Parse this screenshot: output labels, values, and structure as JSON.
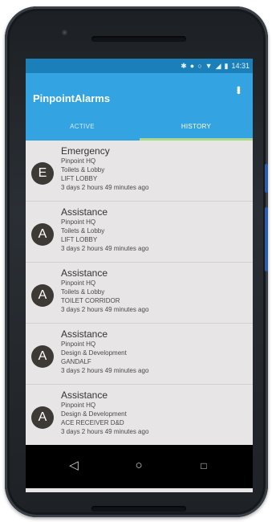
{
  "status_bar": {
    "time": "14:31",
    "icons": [
      "bluetooth-icon",
      "alarm-clock-icon",
      "do-not-disturb-icon",
      "wifi-icon",
      "signal-icon",
      "battery-icon"
    ]
  },
  "app_bar": {
    "title": "PinpointAlarms",
    "overflow_icon": "more-vert-icon"
  },
  "tabs": {
    "active_label": "ACTIVE",
    "history_label": "HISTORY",
    "selected": "HISTORY"
  },
  "alarms": [
    {
      "initial": "E",
      "type": "Emergency",
      "site": "Pinpoint HQ",
      "area": "Toilets & Lobby",
      "location": "LIFT LOBBY",
      "time": "3 days 2 hours 49 minutes ago"
    },
    {
      "initial": "A",
      "type": "Assistance",
      "site": "Pinpoint HQ",
      "area": "Toilets & Lobby",
      "location": "LIFT LOBBY",
      "time": "3 days 2 hours 49 minutes ago"
    },
    {
      "initial": "A",
      "type": "Assistance",
      "site": "Pinpoint HQ",
      "area": "Toilets & Lobby",
      "location": "TOILET CORRIDOR",
      "time": "3 days 2 hours 49 minutes ago"
    },
    {
      "initial": "A",
      "type": "Assistance",
      "site": "Pinpoint HQ",
      "area": "Design & Development",
      "location": "GANDALF",
      "time": "3 days 2 hours 49 minutes ago"
    },
    {
      "initial": "A",
      "type": "Assistance",
      "site": "Pinpoint HQ",
      "area": "Design & Development",
      "location": "ACE RECEIVER    D&D",
      "time": "3 days 2 hours 49 minutes ago"
    }
  ],
  "nav_bar": {
    "back_icon": "back-triangle-icon",
    "home_icon": "home-circle-icon",
    "recents_icon": "recents-square-icon"
  },
  "colors": {
    "app_bar": "#33a3e1",
    "status_bar": "#1b7fb9",
    "tab_indicator": "#a8d98c",
    "avatar": "#3d3a35",
    "list_background": "#e8e5e6"
  }
}
